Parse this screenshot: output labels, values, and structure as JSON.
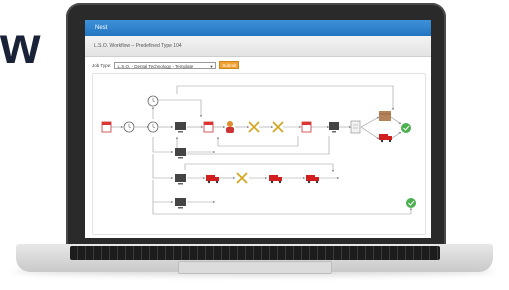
{
  "brand": {
    "text": "w"
  },
  "app": {
    "title": "Nest",
    "subtitle": "L.S.O. Workflow – Predefined Type 104",
    "job_type_label": "Job Type:",
    "job_type_value": "L.S.O. - Dental Technology - Template",
    "submit_label": "Submit"
  },
  "colors": {
    "accent": "#2a7fcf",
    "button": "#f0a030",
    "truck": "#d11e1e",
    "check": "#4caf50"
  }
}
